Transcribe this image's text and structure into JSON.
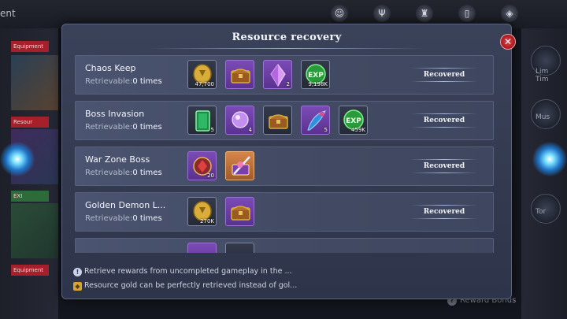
{
  "background": {
    "top_label": "ent",
    "left_tags": [
      "Equipment",
      "Resour",
      "EXI",
      "Equipment"
    ],
    "right_labels": [
      "Lim\nTim",
      "Mus",
      "Tor"
    ],
    "reward_bonus": "Reward Bonus"
  },
  "modal": {
    "title": "Resource recovery",
    "close_icon": "close-icon",
    "rows": [
      {
        "name": "Chaos Keep",
        "retrieve_label": "Retrievable:",
        "times": "0 times",
        "button": "Recovered",
        "items": [
          {
            "icon": "gold-coin-icon",
            "quality": "dark",
            "qty": "47,700"
          },
          {
            "icon": "treasure-chest-icon",
            "quality": "purple",
            "qty": ""
          },
          {
            "icon": "purple-crystal-icon",
            "quality": "purple",
            "qty": "2"
          },
          {
            "icon": "exp-orb-icon",
            "quality": "dark",
            "qty": "9,198K"
          }
        ]
      },
      {
        "name": "Boss Invasion",
        "retrieve_label": "Retrievable:",
        "times": "0 times",
        "button": "Recovered",
        "items": [
          {
            "icon": "green-tome-icon",
            "quality": "dark",
            "qty": "5"
          },
          {
            "icon": "purple-orb-icon",
            "quality": "purple",
            "qty": "4"
          },
          {
            "icon": "treasure-chest-icon",
            "quality": "dark",
            "qty": ""
          },
          {
            "icon": "blue-feather-icon",
            "quality": "purple",
            "qty": "5"
          },
          {
            "icon": "exp-orb-icon",
            "quality": "dark",
            "qty": "459K"
          }
        ]
      },
      {
        "name": "War Zone Boss",
        "retrieve_label": "Retrievable:",
        "times": "0 times",
        "button": "Recovered",
        "items": [
          {
            "icon": "red-gem-icon",
            "quality": "purple",
            "qty": "20"
          },
          {
            "icon": "sword-chest-icon",
            "quality": "orange",
            "qty": ""
          }
        ]
      },
      {
        "name": "Golden Demon L...",
        "retrieve_label": "Retrievable:",
        "times": "0 times",
        "button": "Recovered",
        "items": [
          {
            "icon": "gold-coin-icon",
            "quality": "dark",
            "qty": "270K"
          },
          {
            "icon": "treasure-chest-icon",
            "quality": "purple",
            "qty": ""
          }
        ]
      }
    ],
    "tips": [
      {
        "icon": "info-icon",
        "text": "Retrieve rewards from uncompleted gameplay in the ..."
      },
      {
        "icon": "gold-coin-icon",
        "text": "Resource gold can be perfectly retrieved instead of gol..."
      }
    ]
  },
  "colors": {
    "panel": "#363d54",
    "row": "#4b5470",
    "purple_item": "#7c4bb6",
    "orange_item": "#d7864a",
    "close": "#c8262c"
  }
}
